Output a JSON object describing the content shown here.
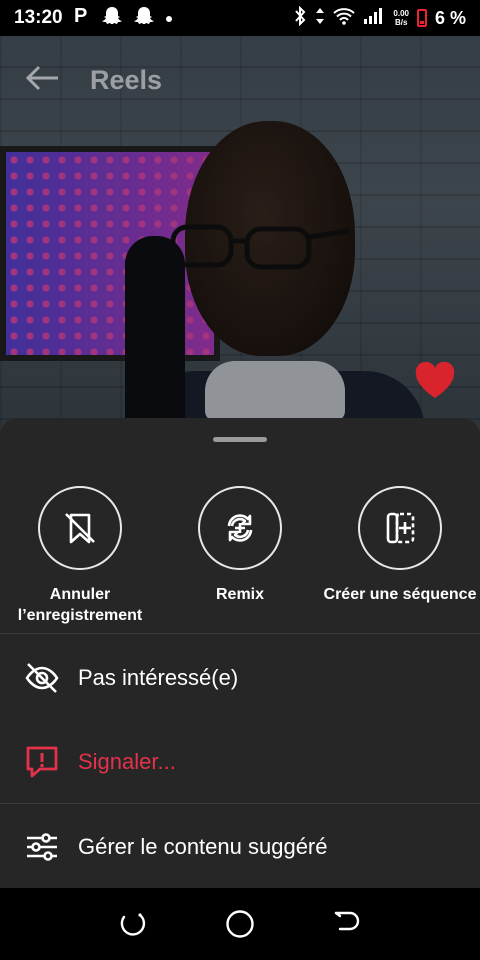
{
  "status_bar": {
    "time": "13:20",
    "net_speed_value": "0.00",
    "net_speed_unit": "B/s",
    "battery_percent": "6 %"
  },
  "header": {
    "title": "Reels"
  },
  "actions": [
    {
      "label": "Annuler l’enregistrement",
      "icon": "bookmark-off-icon"
    },
    {
      "label": "Remix",
      "icon": "remix-icon"
    },
    {
      "label": "Créer une séquence",
      "icon": "sequence-icon"
    }
  ],
  "menu": {
    "not_interested": "Pas intéressé(e)",
    "report": "Signaler...",
    "manage_suggested": "Gérer le contenu suggéré"
  },
  "colors": {
    "danger": "#e3324a",
    "heart": "#d9242e",
    "sheet_bg": "#262626"
  }
}
